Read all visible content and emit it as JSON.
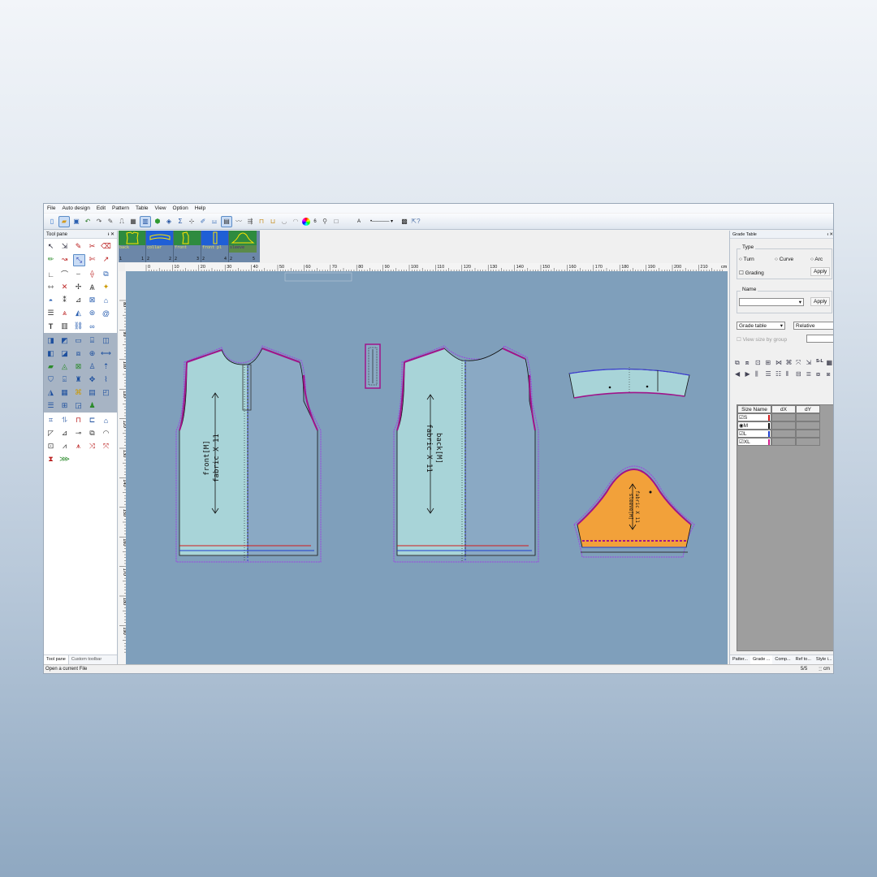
{
  "menu": [
    "File",
    "Auto design",
    "Edit",
    "Pattern",
    "Table",
    "View",
    "Option",
    "Help"
  ],
  "toolbar": {
    "line_width_value": "6",
    "line_style_label": "A"
  },
  "tool_pane": {
    "title": "Tool pane",
    "tabs": [
      "Tool pane",
      "Custom toolbar"
    ]
  },
  "pieces": [
    {
      "name": "back",
      "count": "1",
      "number": "1",
      "bg": "#2e8b3f"
    },
    {
      "name": "collar",
      "count": "2",
      "number": "2",
      "bg": "#1f5fd6"
    },
    {
      "name": "front",
      "count": "2",
      "number": "3",
      "bg": "#2e8b3f"
    },
    {
      "name": "front pl",
      "count": "2",
      "number": "4",
      "bg": "#1f5fd6"
    },
    {
      "name": "sleeve",
      "count": "2",
      "number": "5",
      "bg": "#2e8b3f"
    }
  ],
  "ruler": {
    "top_ticks": [
      "0",
      "10",
      "20",
      "30",
      "40",
      "50",
      "60",
      "70",
      "80",
      "90",
      "100",
      "110",
      "120",
      "130",
      "140",
      "150",
      "160",
      "170",
      "180",
      "190",
      "200",
      "210"
    ],
    "unit": "cm",
    "left_ticks": [
      "80",
      "90",
      "100",
      "110",
      "120",
      "130",
      "140",
      "150",
      "160",
      "170",
      "180",
      "190"
    ]
  },
  "canvas": {
    "front_label": "front[M]",
    "front_fabric": "fabric X 11",
    "back_label": "back[M]",
    "back_fabric": "fabric X 11",
    "sleeve_label": "sleeve[M]",
    "sleeve_fabric": "fabric X 11"
  },
  "grade_table": {
    "title": "Grade Table",
    "type_legend": "Type",
    "type_options": [
      "Turn",
      "Curve",
      "Arc"
    ],
    "grading_label": "Grading",
    "apply_label": "Apply",
    "name_legend": "Name",
    "name_value": "",
    "apply2_label": "Apply",
    "mode_value": "Grade table",
    "relative_value": "Relative",
    "view_group_label": "View size by group",
    "columns": [
      "Size Name",
      "dX",
      "dY"
    ],
    "sizes": [
      {
        "name": "S",
        "color": "#d11b1b",
        "mark": "☑"
      },
      {
        "name": "M",
        "color": "#111111",
        "mark": "◉"
      },
      {
        "name": "L",
        "color": "#1e3fd0",
        "mark": "☑"
      },
      {
        "name": "XL",
        "color": "#d41b8c",
        "mark": "☑"
      }
    ],
    "tabs": [
      "Patter...",
      "Grade ...",
      "Comp...",
      "Ref to...",
      "Style i..."
    ]
  },
  "status": {
    "message": "Open a current File",
    "page": "5/5",
    "unit": "cm"
  }
}
